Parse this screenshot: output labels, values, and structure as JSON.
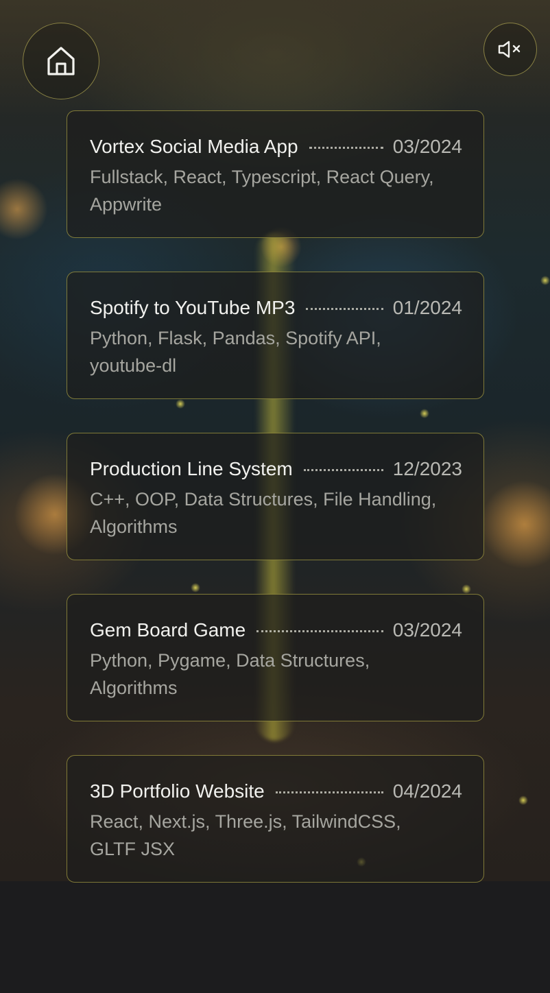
{
  "nav": {
    "home_icon": "home-icon",
    "mute_icon": "speaker-muted-icon"
  },
  "projects": [
    {
      "title": "Vortex Social Media App",
      "date": "03/2024",
      "tech": "Fullstack, React, Typescript, React Query, Appwrite"
    },
    {
      "title": "Spotify to YouTube MP3",
      "date": "01/2024",
      "tech": "Python, Flask, Pandas, Spotify API, youtube-dl"
    },
    {
      "title": "Production Line System",
      "date": "12/2023",
      "tech": "C++, OOP, Data Structures, File Handling, Algorithms"
    },
    {
      "title": "Gem Board Game",
      "date": "03/2024",
      "tech": "Python, Pygame, Data Structures, Algorithms"
    },
    {
      "title": "3D Portfolio Website",
      "date": "04/2024",
      "tech": "React, Next.js, Three.js, TailwindCSS, GLTF JSX"
    }
  ],
  "colors": {
    "accent_border": "#b4aa46",
    "background": "#1c1c1e",
    "title_text": "#f1f1ee",
    "secondary_text": "#a6a6a0"
  }
}
